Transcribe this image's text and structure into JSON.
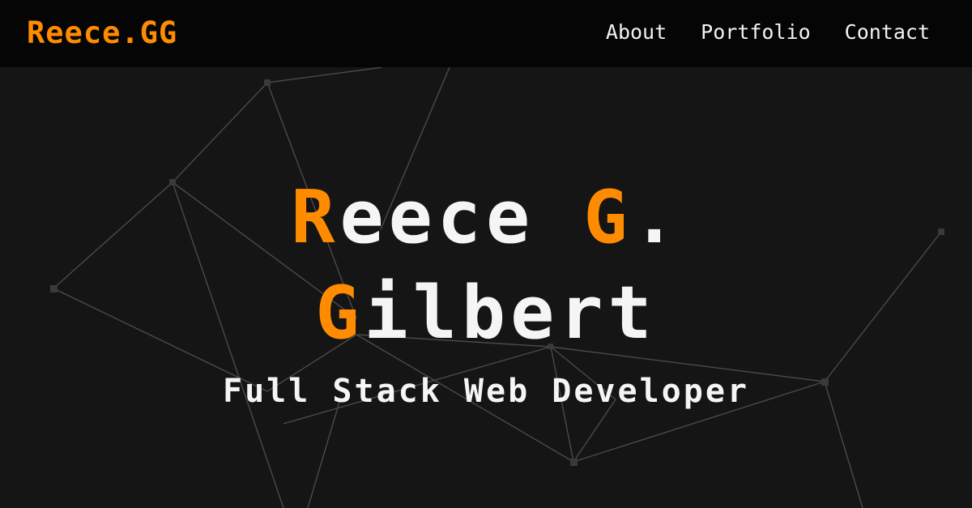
{
  "nav": {
    "logo": "Reece.GG",
    "links": [
      "About",
      "Portfolio",
      "Contact"
    ]
  },
  "hero": {
    "line1": {
      "initial": "R",
      "rest": "eece ",
      "initial2": "G",
      "tail": "."
    },
    "line2": {
      "initial": "G",
      "rest": "ilbert"
    },
    "tagline": "Full Stack Web Developer"
  },
  "colors": {
    "accent": "#ff8c00",
    "background": "#151515",
    "nav_background": "#050505",
    "text": "#f5f5f5"
  }
}
